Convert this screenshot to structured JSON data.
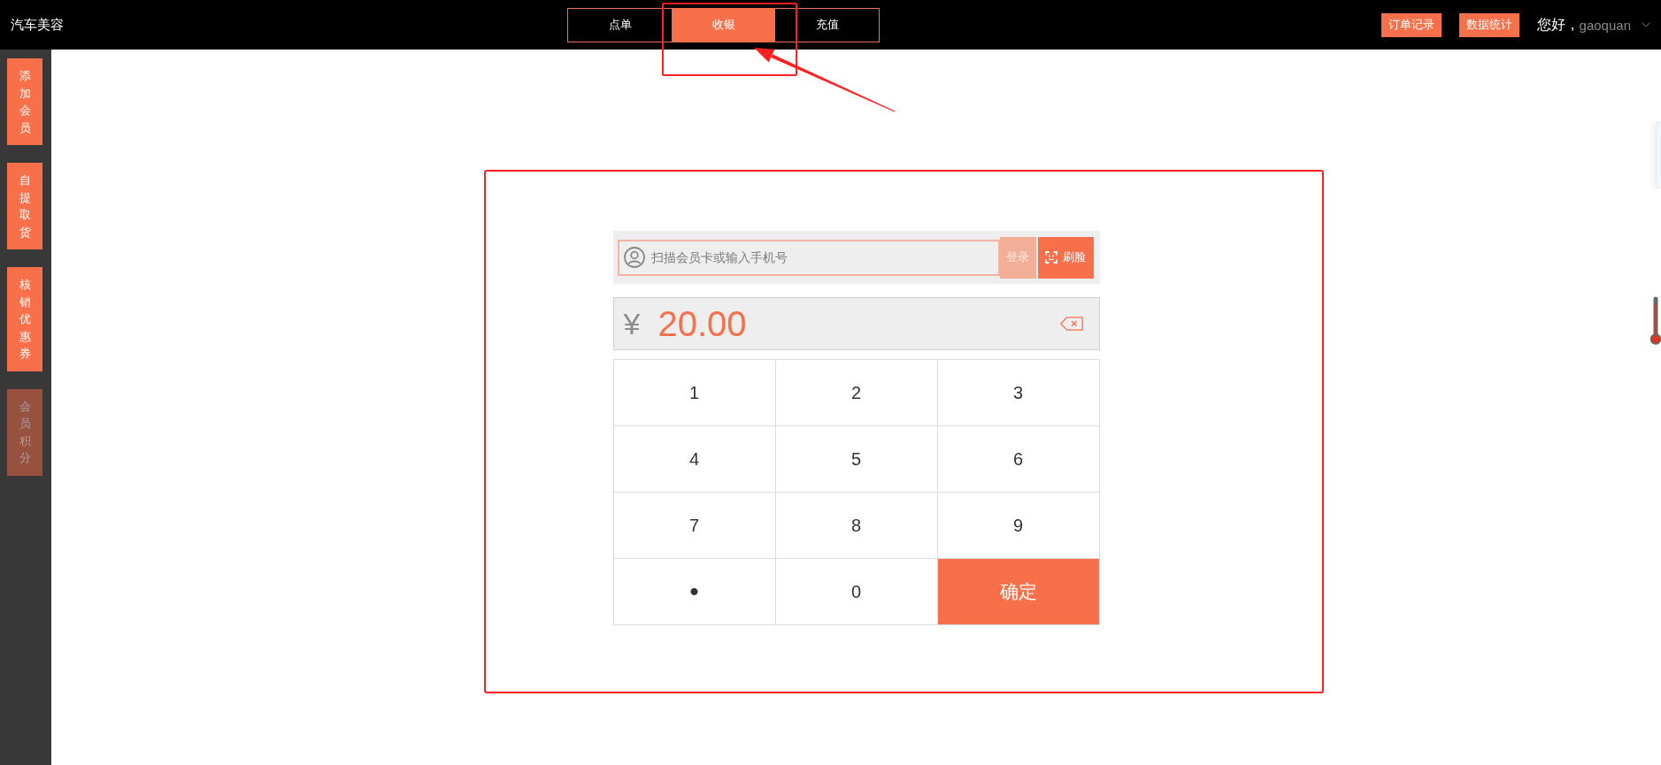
{
  "app_title": "汽车美容",
  "nav_tabs": [
    {
      "label": "点单",
      "selected": false
    },
    {
      "label": "收银",
      "selected": true
    },
    {
      "label": "充值",
      "selected": false
    }
  ],
  "header_buttons": [
    "订单记录",
    "数据统计"
  ],
  "user": {
    "greeting": "您好，",
    "name": "gaoquan"
  },
  "sidebar": {
    "items": [
      {
        "label": "添加会员",
        "disabled": false
      },
      {
        "label": "自提取货",
        "disabled": false
      },
      {
        "label": "核销优惠券",
        "disabled": false
      },
      {
        "label": "会员积分",
        "disabled": true
      }
    ]
  },
  "member_search": {
    "placeholder": "扫描会员卡或输入手机号",
    "login_button": {
      "label": "登录",
      "disabled": true
    },
    "face_button": "刷脸"
  },
  "amount": {
    "currency": "¥",
    "value": "20.00"
  },
  "keypad": {
    "keys": [
      {
        "label": "1",
        "kind": "key"
      },
      {
        "label": "2",
        "kind": "key"
      },
      {
        "label": "3",
        "kind": "key"
      },
      {
        "label": "4",
        "kind": "key"
      },
      {
        "label": "5",
        "kind": "key"
      },
      {
        "label": "6",
        "kind": "key"
      },
      {
        "label": "7",
        "kind": "key"
      },
      {
        "label": "8",
        "kind": "key"
      },
      {
        "label": "9",
        "kind": "key"
      },
      {
        "label": "•",
        "kind": "dot"
      },
      {
        "label": "0",
        "kind": "key"
      },
      {
        "label": "确定",
        "kind": "confirm"
      }
    ]
  }
}
